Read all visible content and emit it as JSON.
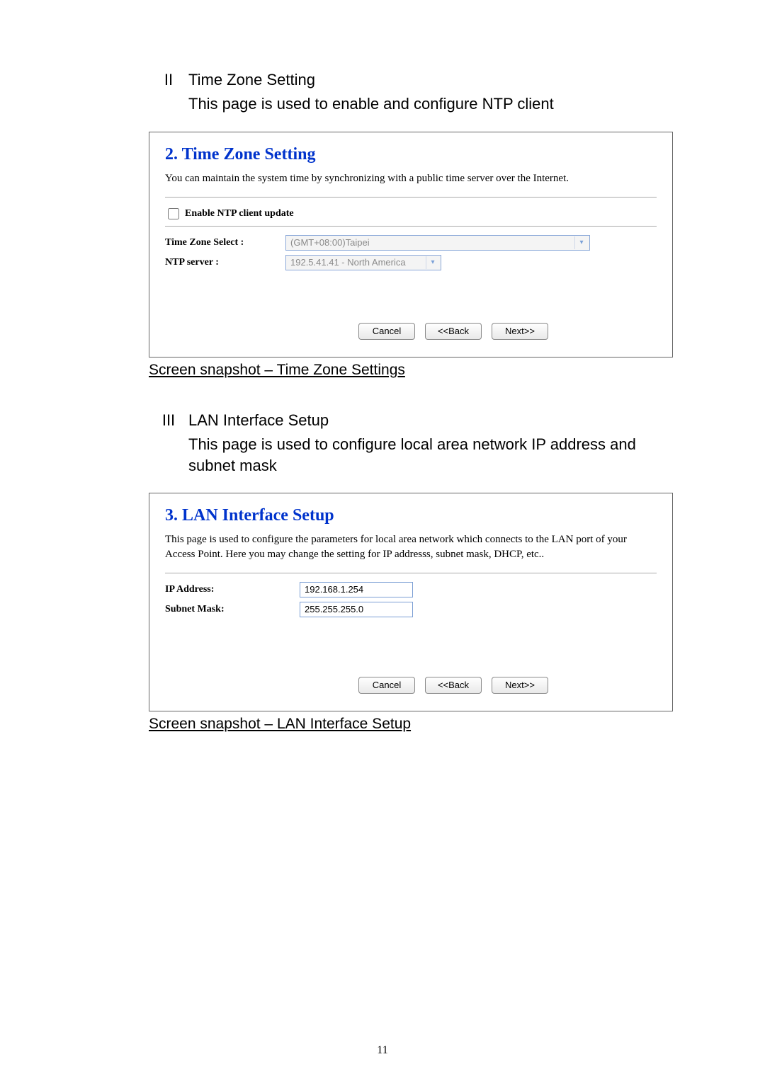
{
  "page_number": "11",
  "section2": {
    "roman": "II",
    "title": "Time Zone Setting",
    "desc": "This page is used to enable and configure NTP client",
    "panel": {
      "title": "2. Time Zone Setting",
      "desc": "You can maintain the system time by synchronizing with a public time server over the Internet.",
      "enable_label": "Enable NTP client update",
      "tz_label": "Time Zone Select :",
      "tz_value": "(GMT+08:00)Taipei",
      "ntp_label": "NTP server :",
      "ntp_value": "192.5.41.41 - North America",
      "btn_cancel": "Cancel",
      "btn_back": "<<Back",
      "btn_next": "Next>>"
    },
    "caption": "Screen snapshot – Time Zone Settings"
  },
  "section3": {
    "roman": "III",
    "title": "LAN Interface Setup",
    "desc": "This page is used to configure local area network IP address and subnet mask",
    "panel": {
      "title": "3. LAN Interface Setup",
      "desc": "This page is used to configure the parameters for local area network which connects to the LAN port of your Access Point. Here you may change the setting for IP addresss, subnet mask, DHCP, etc..",
      "ip_label": "IP Address:",
      "ip_value": "192.168.1.254",
      "mask_label": "Subnet Mask:",
      "mask_value": "255.255.255.0",
      "btn_cancel": "Cancel",
      "btn_back": "<<Back",
      "btn_next": "Next>>"
    },
    "caption": "Screen snapshot – LAN Interface Setup"
  }
}
